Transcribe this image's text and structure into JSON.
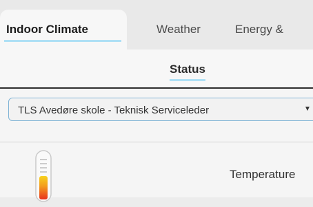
{
  "tabs": [
    {
      "label": "Indoor Climate",
      "active": true
    },
    {
      "label": "Weather",
      "active": false
    },
    {
      "label": "Energy &",
      "active": false
    }
  ],
  "subtabs": [
    {
      "label": "Status",
      "active": true
    }
  ],
  "location_select": {
    "selected": "TLS Avedøre skole - Teknisk Serviceleder",
    "arrow": "▼"
  },
  "metrics": [
    {
      "label": "Temperature",
      "icon": "thermometer-icon"
    }
  ],
  "colors": {
    "underline": "#aee0f5",
    "select_border": "#7fb4d6",
    "thermo_red": "#e8321e",
    "thermo_orange": "#f39a1e",
    "thermo_yellow": "#f7d21f"
  }
}
